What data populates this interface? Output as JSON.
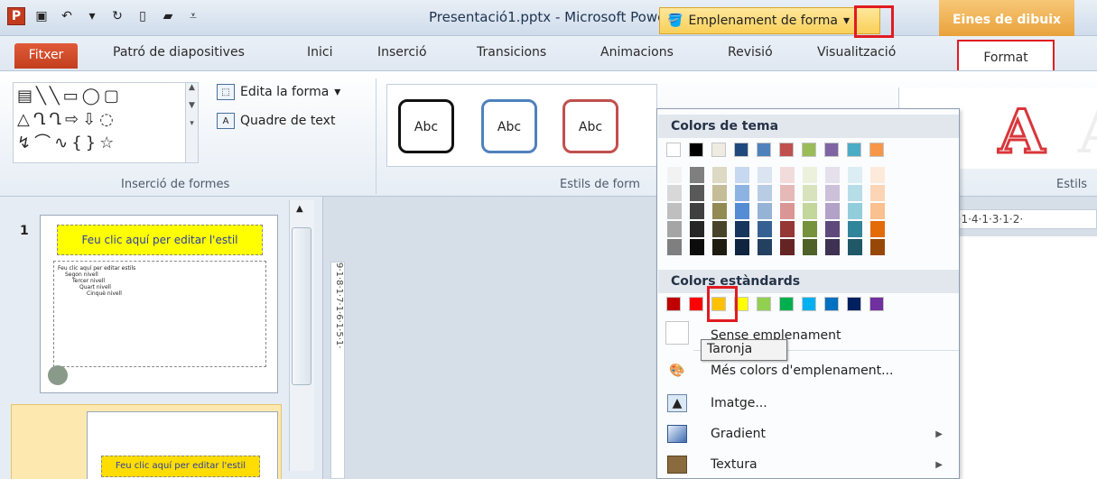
{
  "titlebar": {
    "title": "Presentació1.pptx - Microsoft PowerPoint",
    "contextual_tab": "Eines de dibuix",
    "qat": {
      "logo": "P"
    }
  },
  "tabs": [
    "Fitxer",
    "Patró de diapositives",
    "Inici",
    "Inserció",
    "Transicions",
    "Animacions",
    "Revisió",
    "Visualització",
    "Format"
  ],
  "ribbon": {
    "insert_shapes_label": "Inserció de formes",
    "edit_shape": "Edita la forma",
    "text_box": "Quadre de text",
    "shape_styles_label": "Estils de form",
    "styles_sample": "Abc",
    "wordart_label": "Estils",
    "fill_button": "Emplenament de forma",
    "shape_rows": [
      [
        "▤",
        "╲",
        "╲",
        "▭",
        "◯",
        "▢"
      ],
      [
        "△",
        "Ղ",
        "Ղ",
        "⇨",
        "⇩",
        "◌"
      ],
      [
        "↯",
        "⌒",
        "∿",
        "{",
        "}",
        "☆"
      ]
    ]
  },
  "thumbnails": {
    "slide_number": "1",
    "slide1_title": "Feu clic aquí per editar l'estil",
    "slide1_body": [
      "Feu clic aquí per editar estils",
      "Segon nivell",
      "Tercer nivell",
      "Quart nivell",
      "Cinquè nivell"
    ],
    "slide2_title": "Feu clic aquí per editar l'estil"
  },
  "ruler_h": "5·1·4·1·3·1·2·",
  "ruler_v": "9·1·8·1·7·1·6·1·5·1·",
  "fill_menu": {
    "theme_colors_header": "Colors de tema",
    "standard_colors_header": "Colors estàndards",
    "no_fill": "Sense emplenament",
    "more_colors": "Més colors d'emplenament...",
    "picture": "Imatge...",
    "gradient": "Gradient",
    "texture": "Textura",
    "tooltip": "Taronja",
    "theme_colors": [
      "#ffffff",
      "#000000",
      "#eeece1",
      "#1f497d",
      "#4f81bd",
      "#c0504d",
      "#9bbb59",
      "#8064a2",
      "#4bacc6",
      "#f79646"
    ],
    "standard_colors": [
      "#c00000",
      "#ff0000",
      "#ffc000",
      "#ffff00",
      "#92d050",
      "#00b050",
      "#00b0f0",
      "#0070c0",
      "#002060",
      "#7030a0"
    ],
    "theme_shades": [
      [
        "#f2f2f2",
        "#d8d8d8",
        "#bfbfbf",
        "#a5a5a5",
        "#7f7f7f"
      ],
      [
        "#7f7f7f",
        "#595959",
        "#3f3f3f",
        "#262626",
        "#0c0c0c"
      ],
      [
        "#ddd9c3",
        "#c4bd97",
        "#938953",
        "#494429",
        "#1d1b10"
      ],
      [
        "#c6d9f0",
        "#8db3e2",
        "#548dd4",
        "#17365d",
        "#0f243e"
      ],
      [
        "#dbe5f1",
        "#b8cce4",
        "#95b3d7",
        "#366092",
        "#244061"
      ],
      [
        "#f2dcdb",
        "#e5b9b7",
        "#d99694",
        "#953734",
        "#632423"
      ],
      [
        "#ebf1dd",
        "#d7e3bc",
        "#c3d69b",
        "#76923c",
        "#4f6128"
      ],
      [
        "#e5e0ec",
        "#ccc1d9",
        "#b2a2c7",
        "#5f497a",
        "#3f3151"
      ],
      [
        "#dbeef3",
        "#b7dde8",
        "#92cddc",
        "#31859b",
        "#205867"
      ],
      [
        "#fdeada",
        "#fbd5b5",
        "#fac08f",
        "#e36c09",
        "#974806"
      ]
    ]
  }
}
